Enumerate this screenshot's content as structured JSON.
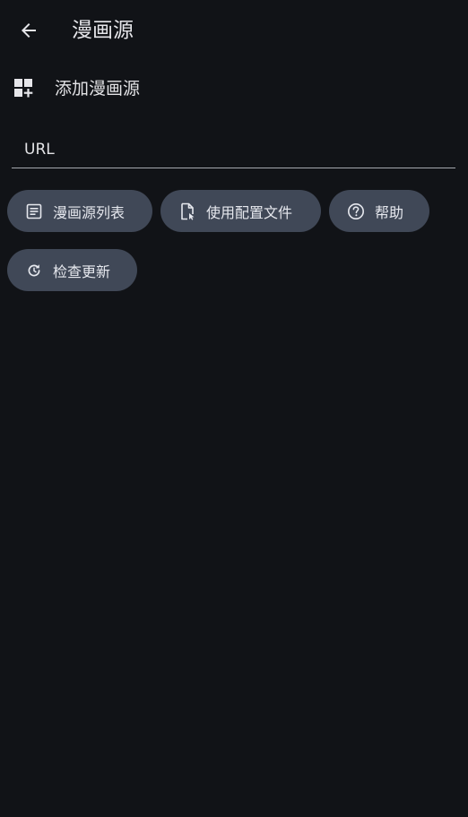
{
  "app_bar": {
    "back_icon": "arrow-left-icon",
    "title": "漫画源"
  },
  "section": {
    "icon": "add-widget-icon",
    "title": "添加漫画源"
  },
  "url_field": {
    "placeholder": "URL",
    "value": ""
  },
  "actions": {
    "source_list": {
      "icon": "list-icon",
      "label": "漫画源列表"
    },
    "use_config_file": {
      "icon": "file-select-icon",
      "label": "使用配置文件"
    },
    "help": {
      "icon": "help-circle-icon",
      "label": "帮助"
    },
    "check_updates": {
      "icon": "refresh-icon",
      "label": "检查更新"
    }
  },
  "colors": {
    "background": "#111317",
    "chip_background": "#404857",
    "text": "#e3e3e6",
    "divider": "#a5a8ae"
  }
}
